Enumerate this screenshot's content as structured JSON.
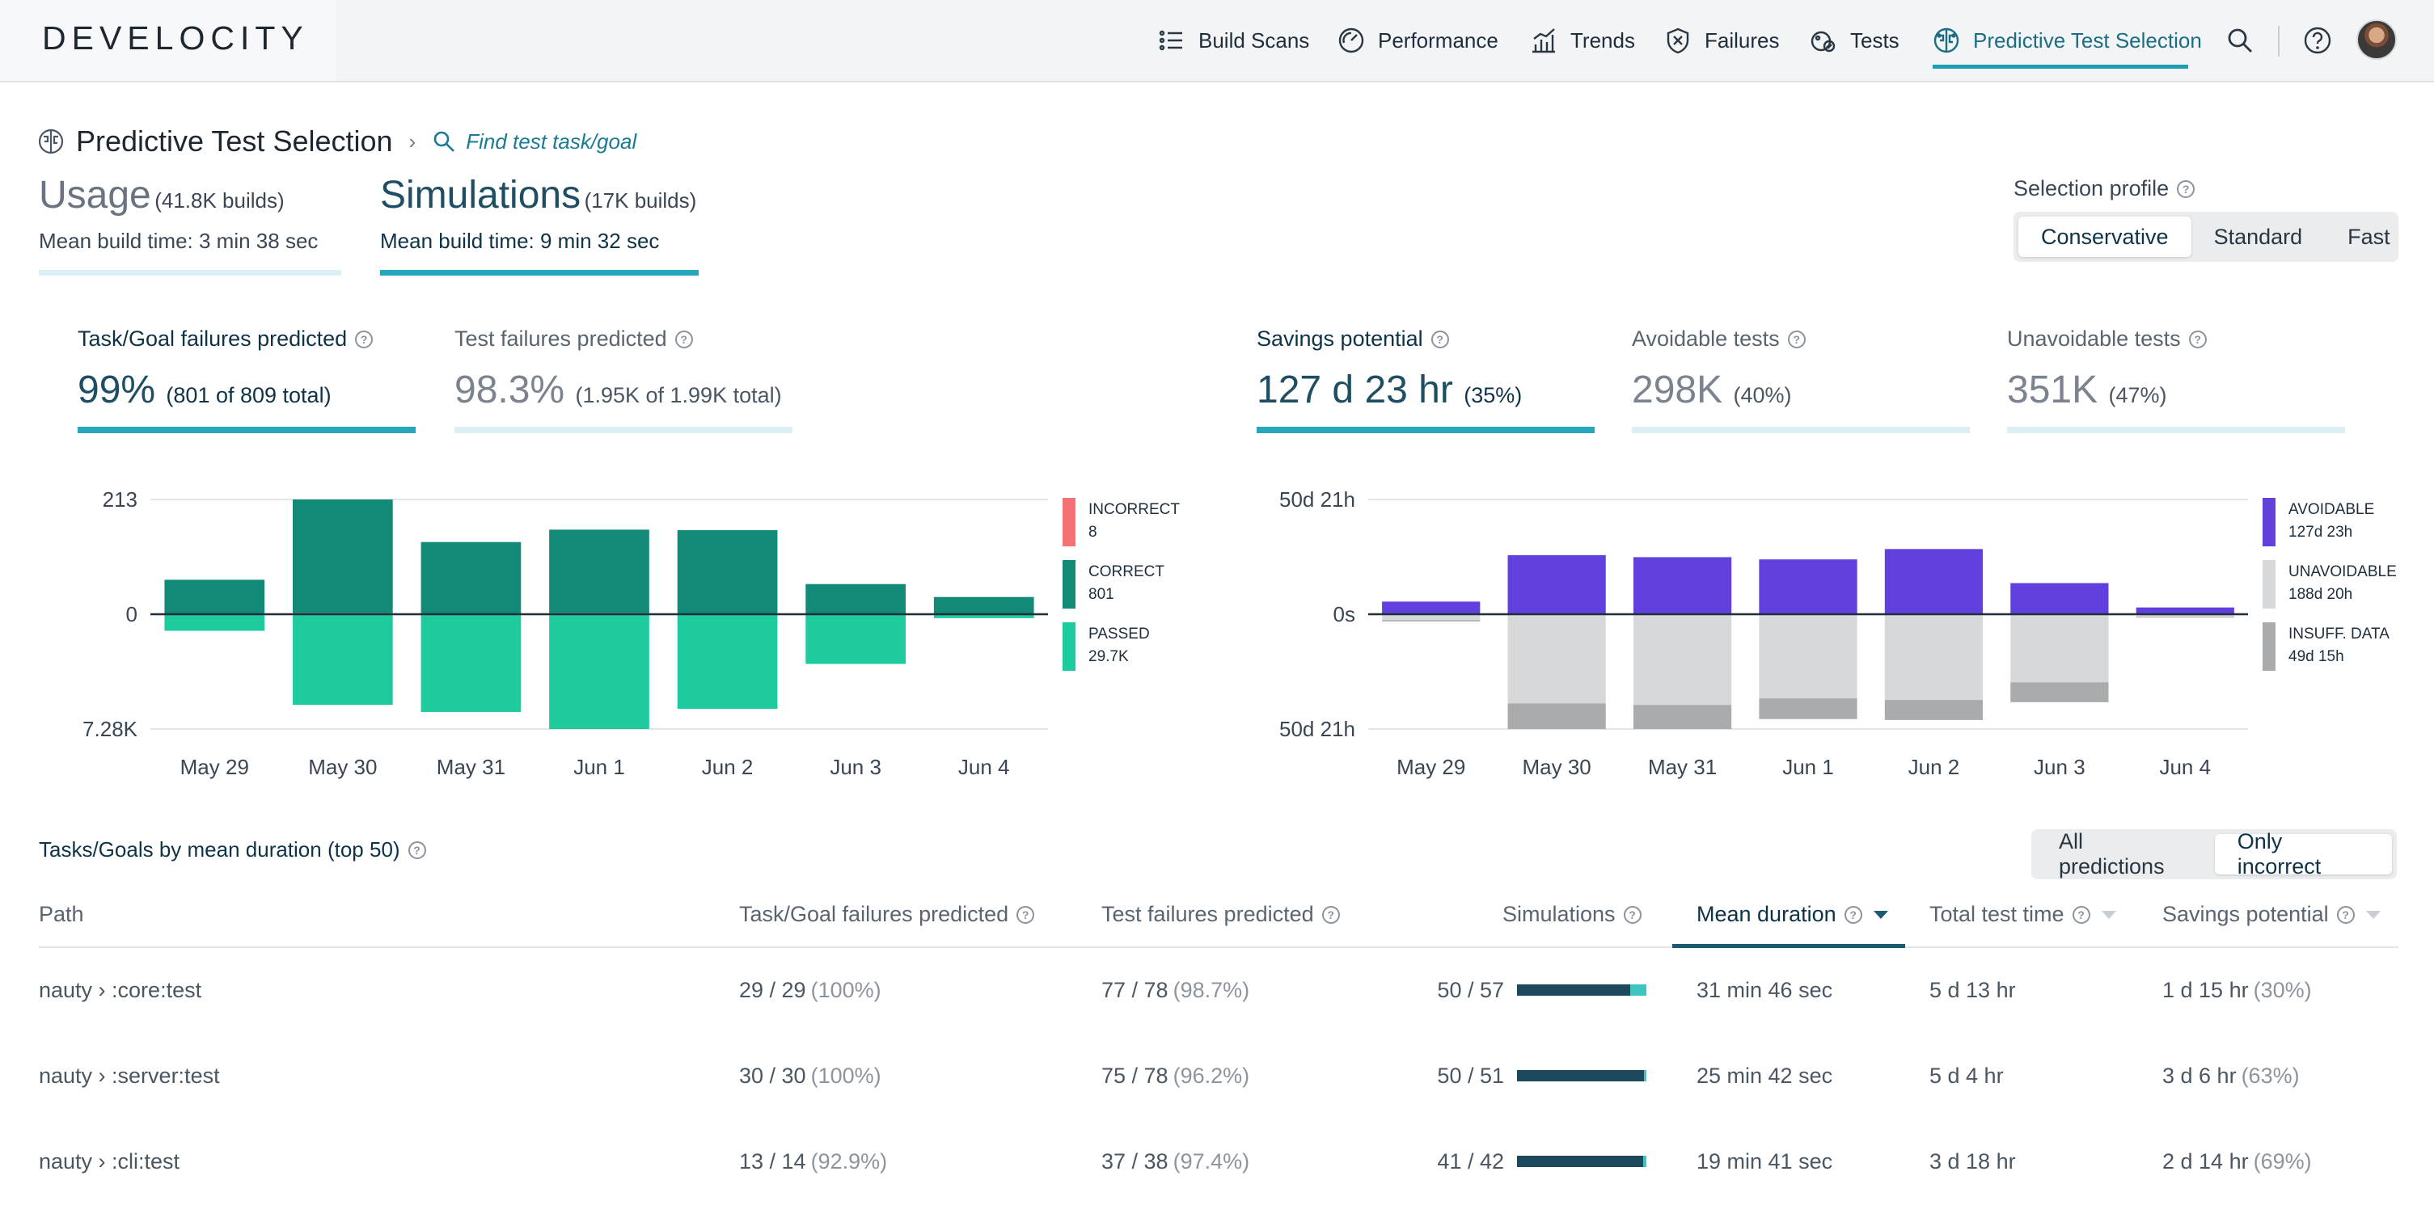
{
  "app": {
    "logo": "DEVELOCITY"
  },
  "nav": {
    "items": [
      {
        "label": "Build Scans",
        "icon": "list-icon"
      },
      {
        "label": "Performance",
        "icon": "gauge-icon"
      },
      {
        "label": "Trends",
        "icon": "trends-icon"
      },
      {
        "label": "Failures",
        "icon": "shield-x-icon"
      },
      {
        "label": "Tests",
        "icon": "flask-icon"
      },
      {
        "label": "Predictive Test Selection",
        "icon": "brain-icon",
        "active": true
      }
    ]
  },
  "header": {
    "title": "Predictive Test Selection",
    "breadcrumb_sep": "›",
    "find_link": "Find test task/goal"
  },
  "modes": {
    "usage": {
      "title": "Usage",
      "count": "(41.8K builds)",
      "mbt_label": "Mean build time:",
      "mbt_value": "3 min 38 sec"
    },
    "simulations": {
      "title": "Simulations",
      "count": "(17K builds)",
      "mbt_label": "Mean build time:",
      "mbt_value": "9 min 32 sec",
      "active": true
    }
  },
  "selection_profile": {
    "label": "Selection profile",
    "options": [
      "Conservative",
      "Standard",
      "Fast"
    ],
    "selected": "Conservative"
  },
  "metrics_left": [
    {
      "label": "Task/Goal failures predicted",
      "value": "99%",
      "detail": "(801 of 809 total)",
      "active": true
    },
    {
      "label": "Test failures predicted",
      "value": "98.3%",
      "detail": "(1.95K of 1.99K total)",
      "active": false
    }
  ],
  "metrics_right": [
    {
      "label": "Savings potential",
      "value": "127 d 23 hr",
      "detail": "(35%)",
      "active": true
    },
    {
      "label": "Avoidable tests",
      "value": "298K",
      "detail": "(40%)",
      "active": false
    },
    {
      "label": "Unavoidable tests",
      "value": "351K",
      "detail": "(47%)",
      "active": false
    }
  ],
  "chart_data": [
    {
      "type": "bar",
      "categories": [
        "May 29",
        "May 30",
        "May 31",
        "Jun 1",
        "Jun 2",
        "Jun 3",
        "Jun 4"
      ],
      "y_ticks": [
        "213",
        "0",
        "7.28K"
      ],
      "series": [
        {
          "name": "INCORRECT",
          "value_label": "8",
          "color": "#f47174",
          "values": [
            0,
            2,
            0,
            2,
            0,
            0,
            0
          ]
        },
        {
          "name": "CORRECT",
          "value_label": "801",
          "color": "#138a77",
          "values": [
            64,
            211,
            134,
            155,
            156,
            56,
            32
          ]
        },
        {
          "name": "PASSED",
          "value_label": "29.7K",
          "color": "#1ecb9c",
          "values": [
            -1050,
            -5750,
            -6200,
            -7280,
            -6000,
            -3150,
            -250
          ]
        }
      ],
      "layout_note": "diverging chart: positive scale 0–213, negative scale 0–7.28K"
    },
    {
      "type": "bar",
      "categories": [
        "May 29",
        "May 30",
        "May 31",
        "Jun 1",
        "Jun 2",
        "Jun 3",
        "Jun 4"
      ],
      "y_ticks": [
        "50d 21h",
        "0s",
        "50d 21h"
      ],
      "series": [
        {
          "name": "AVOIDABLE",
          "value_label": "127d 23h",
          "color": "#6140de",
          "values_days": [
            5.6,
            26.2,
            25.3,
            24.3,
            28.9,
            13.8,
            3.0
          ]
        },
        {
          "name": "UNAVOIDABLE",
          "value_label": "188d 20h",
          "color": "#d6d8da",
          "values_days": [
            -2.6,
            -39.5,
            -40.2,
            -37.3,
            -38.0,
            -30.2,
            -1.2
          ]
        },
        {
          "name": "INSUFF. DATA",
          "value_label": "49d 15h",
          "color": "#a9abad",
          "values_days": [
            -0.6,
            -11.4,
            -10.7,
            -9.2,
            -8.9,
            -8.8,
            -0.3
          ]
        }
      ]
    }
  ],
  "table": {
    "title": "Tasks/Goals by mean duration (top 50)",
    "filter": {
      "options": [
        "All predictions",
        "Only incorrect"
      ],
      "selected": "Only incorrect"
    },
    "columns": [
      "Path",
      "Task/Goal failures predicted",
      "Test failures predicted",
      "Simulations",
      "Mean duration",
      "Total test time",
      "Savings potential"
    ],
    "sorted_column": "Mean duration",
    "rows": [
      {
        "path": "nauty › :core:test",
        "task_pred": "29 / 29",
        "task_pct": "(100%)",
        "test_pred": "77 / 78",
        "test_pct": "(98.7%)",
        "simulations": "50 / 57",
        "sim_ratio": 0.877,
        "mean_duration": "31 min 46 sec",
        "total_test_time": "5 d 13 hr",
        "savings": "1 d 15 hr",
        "savings_pct": "(30%)"
      },
      {
        "path": "nauty › :server:test",
        "task_pred": "30 / 30",
        "task_pct": "(100%)",
        "test_pred": "75 / 78",
        "test_pct": "(96.2%)",
        "simulations": "50 / 51",
        "sim_ratio": 0.98,
        "mean_duration": "25 min 42 sec",
        "total_test_time": "5 d 4 hr",
        "savings": "3 d 6 hr",
        "savings_pct": "(63%)"
      },
      {
        "path": "nauty › :cli:test",
        "task_pred": "13 / 14",
        "task_pct": "(92.9%)",
        "test_pred": "37 / 38",
        "test_pct": "(97.4%)",
        "simulations": "41 / 42",
        "sim_ratio": 0.976,
        "mean_duration": "19 min 41 sec",
        "total_test_time": "3 d 18 hr",
        "savings": "2 d 14 hr",
        "savings_pct": "(69%)"
      }
    ]
  }
}
